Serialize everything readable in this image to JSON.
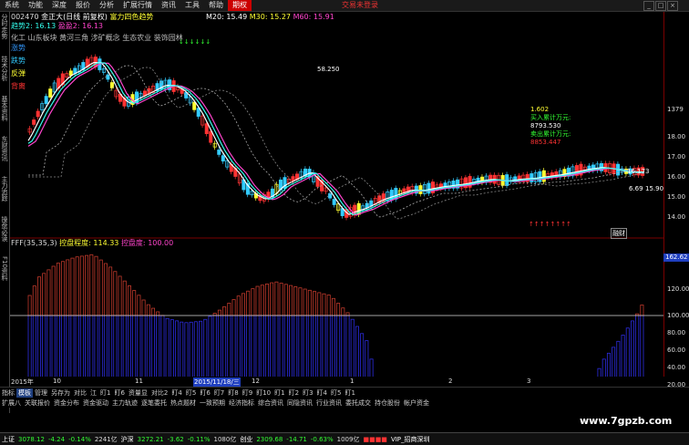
{
  "menu": [
    "系统",
    "功能",
    "深度",
    "报价",
    "分析",
    "扩展行情",
    "资讯",
    "工具",
    "帮助"
  ],
  "menu_active": "期权",
  "alert_text": "交易未登录",
  "header": {
    "code": "002470",
    "name": "金正大(日线 前复权)",
    "indicator": "富力四色趋势",
    "ma20_label": "M20: 15.49",
    "ma30_label": "M30: 15.27",
    "ma60_label": "M60: 15.91",
    "trend_label": "趋势2: 16.13",
    "profit_label": "盈盈2: 16.13"
  },
  "concept_tags": [
    "化工",
    "山东板块",
    "黄河三角",
    "涉矿概念",
    "生态农业",
    "装饰园林"
  ],
  "legend": [
    {
      "label": "涨势",
      "color": "#3399ff"
    },
    {
      "label": "跌势",
      "color": "#33ccff"
    },
    {
      "label": "反弹",
      "color": "#ffff33"
    },
    {
      "label": "背离",
      "color": "#ff3333"
    }
  ],
  "price_annotation": "58.250",
  "price_right_label": "15.90",
  "price_right_label2": "6.69",
  "price_right_label3": "16.173",
  "left_strip_tabs": [
    "分时走势",
    "技术分析",
    "基本资料",
    "东财资讯",
    "主力追踪",
    "操盘必读",
    "F10资料"
  ],
  "right_axis_ticks": [
    "1379",
    "18.00",
    "17.00",
    "16.00",
    "15.00",
    "14.00"
  ],
  "indicator_axis_ticks": [
    "162.62",
    "120.00",
    "100.00",
    "80.00",
    "60.00",
    "40.00",
    "20.00"
  ],
  "info_panel": [
    {
      "text": "1.602",
      "color": "#ffff33"
    },
    {
      "text": "买入累计万元:",
      "color": "#33ff33"
    },
    {
      "text": "8793.530",
      "color": "#fff"
    },
    {
      "text": "卖出累计万元:",
      "color": "#33ff33"
    },
    {
      "text": "8853.447",
      "color": "#ff3333"
    }
  ],
  "subchart_header": {
    "name": "FFF(35,35,3)",
    "ctrl_label": "控盘程度:",
    "ctrl_value": "114.33",
    "ctrl_label2": "控盘度:",
    "ctrl_value2": "100.00"
  },
  "x_axis": {
    "year": "2015年",
    "dates": [
      "10",
      "11",
      "2015/11/18/三",
      "12",
      "1",
      "2",
      "3"
    ]
  },
  "bottom_tabs_1": [
    "指标",
    "模板",
    "管理",
    "另存为",
    "对比",
    "江",
    "盯1",
    "盯6",
    "资量显",
    "对比2",
    "盯4",
    "盯5",
    "盯6",
    "盯7",
    "盯8",
    "盯9",
    "盯10",
    "盯1",
    "盯2",
    "盯3",
    "盯4",
    "盯5",
    "盯1"
  ],
  "bottom_tabs_2": [
    "扩展八",
    "关联报价",
    "资金分布",
    "资金驱动",
    "主力轨迹",
    "逐笔委托",
    "热点题材",
    "一致预期",
    "经济指标",
    "综合资讯",
    "同隐资讯",
    "行业资讯",
    "委托成交",
    "持仓股份",
    "帐户资金"
  ],
  "status_bar": {
    "sh_name": "上证",
    "sh_value": "3078.12",
    "sh_change": "-4.24",
    "sh_pct": "-0.14%",
    "sh_amount": "2241亿",
    "sz_name": "沪深",
    "sz_value": "3272.21",
    "sz_change": "-3.62",
    "sz_pct": "-0.11%",
    "sz_amount": "1080亿",
    "cy_name": "创业",
    "cy_value": "2309.68",
    "cy_change": "-14.71",
    "cy_pct": "-0.63%",
    "cy_amount": "1009亿",
    "vip": "VIP_招商深圳"
  },
  "watermark": "www.7gpzb.com",
  "colors": {
    "up": "#ff3333",
    "down": "#33ccff",
    "ma_white": "#ffffff",
    "ma_pink": "#ff44cc",
    "ma_cyan": "#33ffee",
    "ma_yellow": "#ffff33",
    "bar_red": "#c0392b",
    "bar_blue": "#2c2ce0"
  }
}
